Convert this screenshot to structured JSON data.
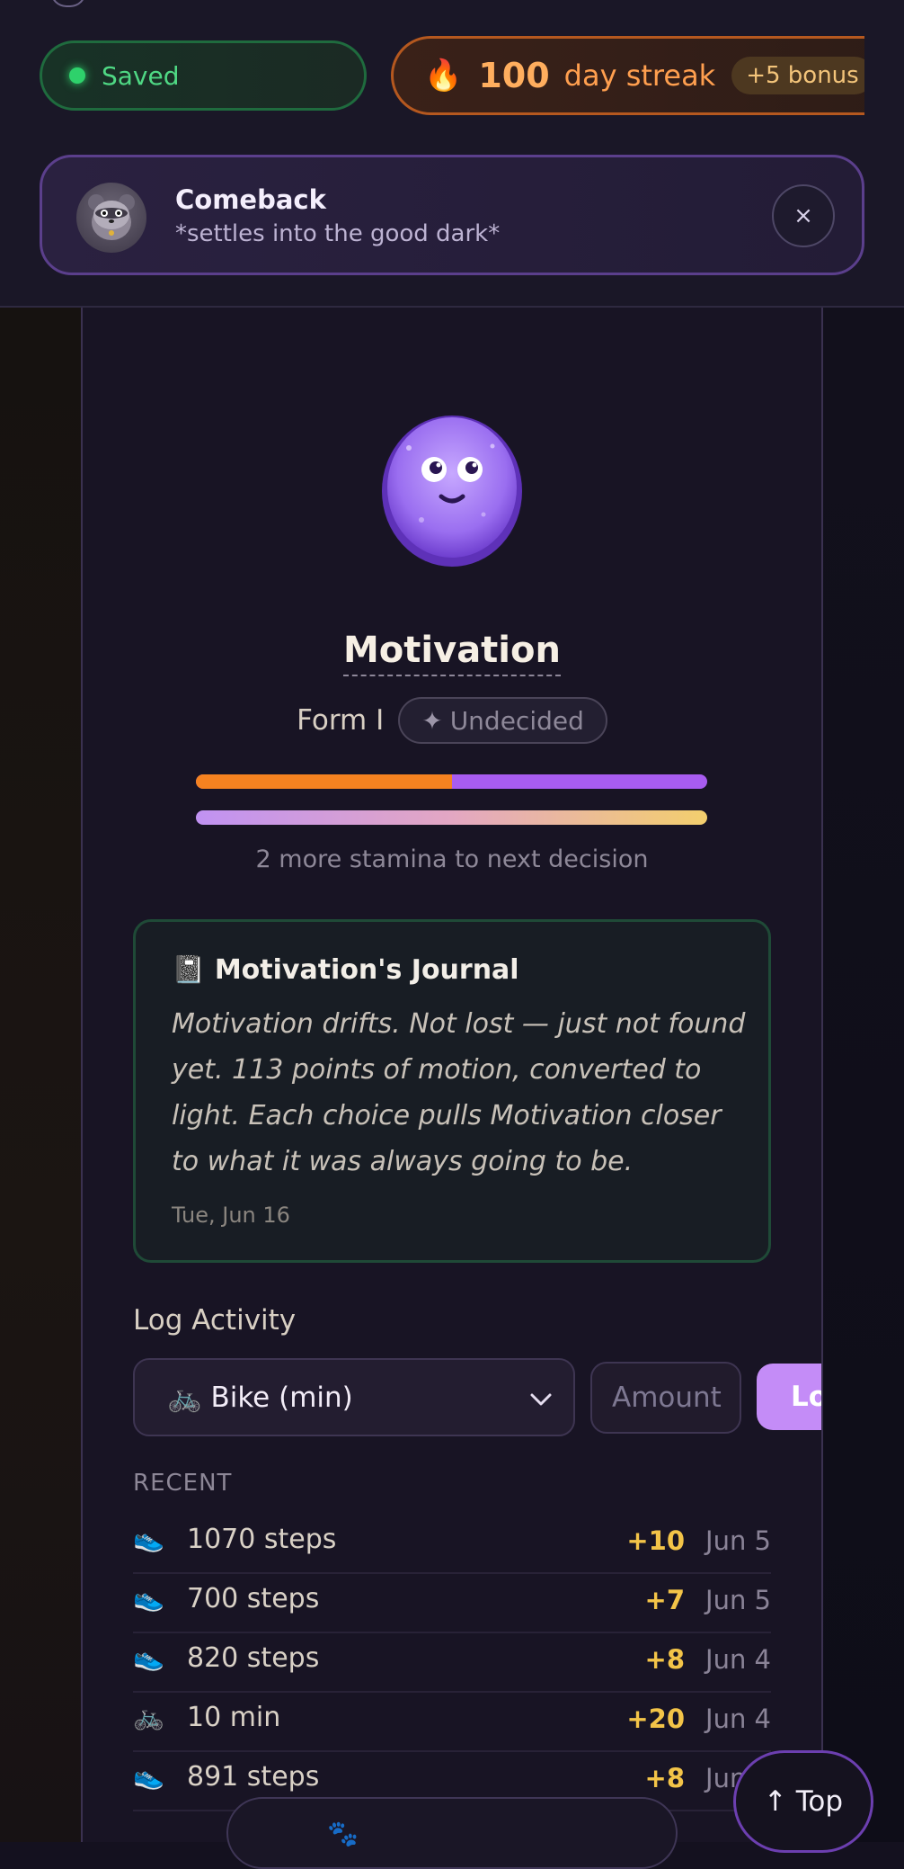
{
  "status": {
    "saved_label": "Saved"
  },
  "streak": {
    "icon": "fire-icon",
    "count": "100",
    "label": "day streak",
    "bonus": "+5 bonus"
  },
  "notification": {
    "title": "Comeback",
    "subtitle": "*settles into the good dark*",
    "close_label": "×"
  },
  "creature": {
    "name": "Motivation",
    "form_label": "Form I",
    "path_label": "Undecided",
    "path_icon": "✦",
    "energy_split_fraction": 0.5,
    "progress_fraction": 1.0,
    "hint": "2 more stamina to next decision"
  },
  "journal": {
    "icon": "📓",
    "title": "Motivation's Journal",
    "body": "Motivation drifts. Not lost — just not found yet. 113 points of motion, converted to light. Each choice pulls Motivation closer to what it was always going to be.",
    "date": "Tue, Jun 16"
  },
  "log_activity": {
    "label": "Log Activity",
    "selected_activity": "🚲 Bike (min)",
    "amount_placeholder": "Amount",
    "submit_label": "Log"
  },
  "recent": {
    "label": "RECENT",
    "items": [
      {
        "icon": "👟",
        "desc": "1070 steps",
        "points": "+10",
        "date": "Jun 5"
      },
      {
        "icon": "👟",
        "desc": "700 steps",
        "points": "+7",
        "date": "Jun 5"
      },
      {
        "icon": "👟",
        "desc": "820 steps",
        "points": "+8",
        "date": "Jun 4"
      },
      {
        "icon": "🚲",
        "desc": "10 min",
        "points": "+20",
        "date": "Jun 4"
      },
      {
        "icon": "👟",
        "desc": "891 steps",
        "points": "+8",
        "date": "Jun 4"
      }
    ]
  },
  "footer": {
    "top_label": "↑ Top"
  },
  "colors": {
    "accent_purple": "#a85cf0",
    "streak_orange": "#f58220",
    "saved_green": "#2ed16b",
    "points_gold": "#f3c448"
  }
}
